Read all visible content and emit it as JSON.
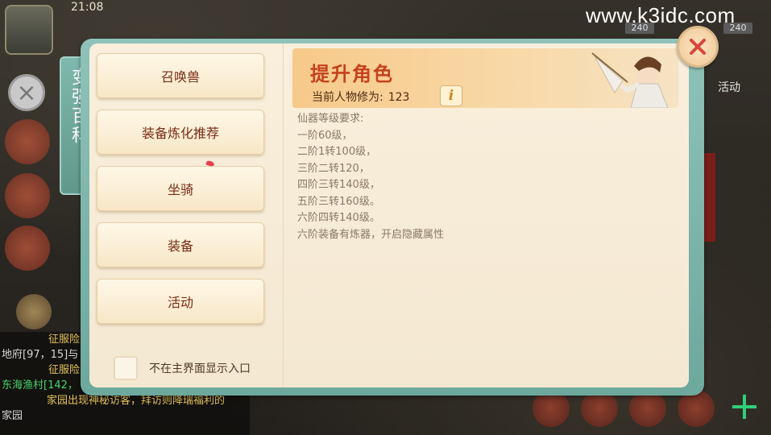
{
  "status": {
    "time": "21:08"
  },
  "watermark": "www.k3idc.com",
  "background": {
    "badges": [
      "240",
      "240"
    ],
    "activity": "活动",
    "chat": [
      {
        "text": "征服险",
        "color": "yellow"
      },
      {
        "text": "地府[97，15]与",
        "color": "yellow"
      },
      {
        "text": "征服险",
        "color": "yellow"
      },
      {
        "text": "东海渔村[142，",
        "color": "green"
      },
      {
        "text": "家园出现神秘访客，拜访则降瑞福利的",
        "color": "yellow"
      },
      {
        "text": "家园",
        "color": "yellow"
      }
    ]
  },
  "panel": {
    "tab_title": "变强百科",
    "categories": [
      "召唤兽",
      "装备炼化推荐",
      "坐骑",
      "装备",
      "活动"
    ],
    "checkbox_label": "不在主界面显示入口",
    "banner": {
      "title": "提升角色",
      "cultivation_label": "当前人物修为:",
      "cultivation_value": "123",
      "info_glyph": "i"
    },
    "requirements": [
      "仙器等级要求:",
      "一阶60级，",
      "二阶1转100级，",
      "三阶二转120，",
      "四阶三转140级，",
      "五阶三转160级。",
      "六阶四转140级。",
      "六阶装备有炼器，开启隐藏属性"
    ]
  },
  "icons": {
    "close": "close-icon",
    "info": "info-icon"
  },
  "colors": {
    "frame": "#7fb8ac",
    "title_red": "#c4421c",
    "button_text": "#7a2c14",
    "close_x": "#d9453a"
  }
}
